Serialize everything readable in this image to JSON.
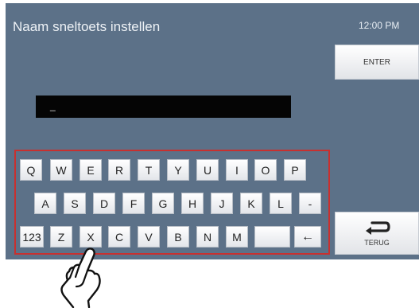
{
  "header": {
    "title": "Naam sneltoets instellen",
    "time": "12:00 PM"
  },
  "buttons": {
    "enter_label": "ENTER",
    "back_label": "TERUG"
  },
  "input": {
    "value": "_"
  },
  "keyboard": {
    "row1": [
      "Q",
      "W",
      "E",
      "R",
      "T",
      "Y",
      "U",
      "I",
      "O",
      "P"
    ],
    "row2": [
      "A",
      "S",
      "D",
      "F",
      "G",
      "H",
      "J",
      "K",
      "L",
      "-"
    ],
    "row3": [
      "123",
      "Z",
      "X",
      "C",
      "V",
      "B",
      "N",
      "M",
      " ",
      "←"
    ]
  },
  "colors": {
    "screen": "#5c7188",
    "highlight_frame": "#c8302f",
    "input_background": "#050505"
  },
  "icons": {
    "back": "back-arrow-icon",
    "pointer": "pointing-hand-icon"
  }
}
